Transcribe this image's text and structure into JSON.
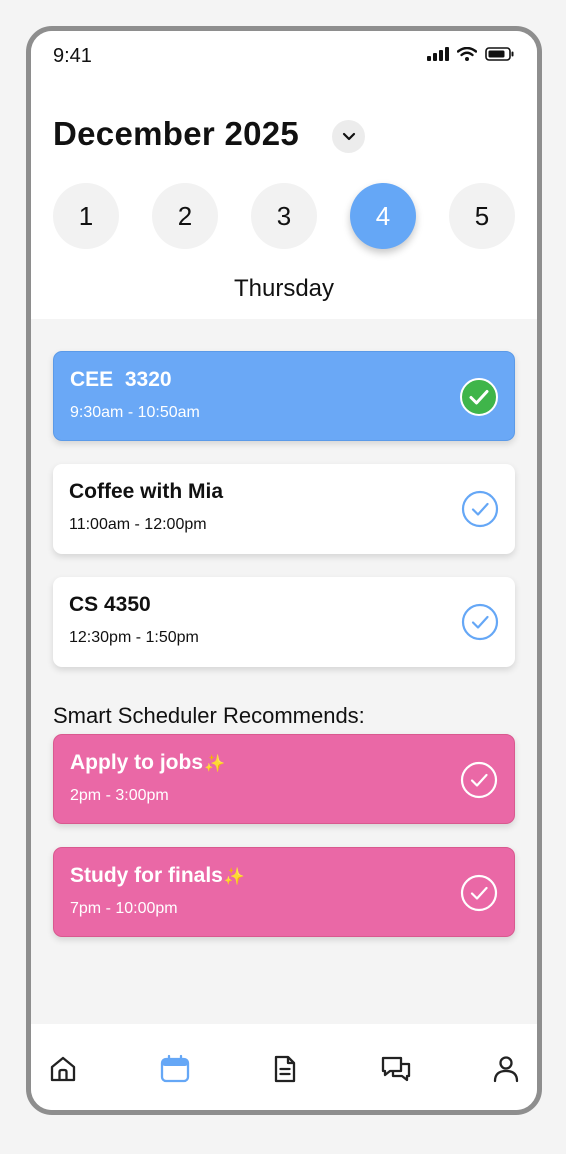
{
  "status": {
    "time": "9:41"
  },
  "header": {
    "month_title": "December 2025",
    "weekday": "Thursday"
  },
  "days": [
    "1",
    "2",
    "3",
    "4",
    "5"
  ],
  "selected_day": "4",
  "events": [
    {
      "title": "CEE  3320",
      "time": "9:30am - 10:50am",
      "style": "blue",
      "completed": true
    },
    {
      "title": "Coffee with Mia",
      "time": "11:00am - 12:00pm",
      "style": "white",
      "completed": false
    },
    {
      "title": "CS 4350",
      "time": "12:30pm - 1:50pm",
      "style": "white",
      "completed": false
    }
  ],
  "recommendations": {
    "label": "Smart Scheduler Recommends:",
    "items": [
      {
        "title": "Apply to jobs",
        "time": "2pm - 3:00pm",
        "icon": "sparkles-icon"
      },
      {
        "title": "Study for finals",
        "time": "7pm - 10:00pm",
        "icon": "sparkles-icon"
      }
    ]
  },
  "nav": [
    "home-icon",
    "calendar-icon",
    "notes-icon",
    "chat-icon",
    "profile-icon"
  ],
  "nav_active": "calendar-icon",
  "colors": {
    "accent_blue": "#65a7f6",
    "pink": "#ea68a6",
    "success_green": "#3fb54a",
    "sparkle": "#ffd84a"
  }
}
